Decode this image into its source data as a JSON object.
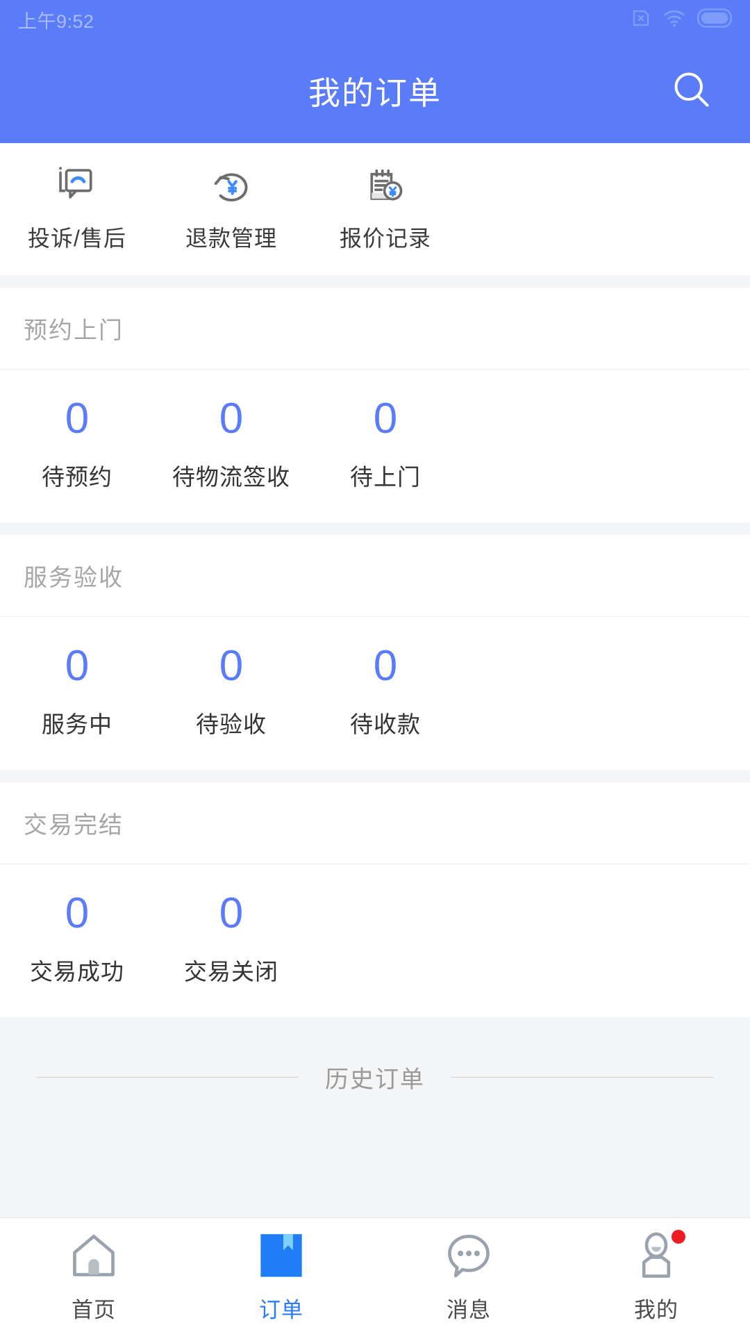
{
  "status_bar": {
    "time": "上午9:52",
    "icons": [
      "sim-no-card-icon",
      "wifi-icon",
      "battery-icon"
    ]
  },
  "app_bar": {
    "title": "我的订单",
    "search_icon": "search-icon"
  },
  "quick_actions": [
    {
      "label": "投诉/售后",
      "icon": "complaint-chat-icon"
    },
    {
      "label": "退款管理",
      "icon": "refund-yen-icon"
    },
    {
      "label": "报价记录",
      "icon": "quote-record-icon"
    }
  ],
  "sections": [
    {
      "title": "预约上门",
      "stats": [
        {
          "count": "0",
          "label": "待预约"
        },
        {
          "count": "0",
          "label": "待物流签收"
        },
        {
          "count": "0",
          "label": "待上门"
        }
      ]
    },
    {
      "title": "服务验收",
      "stats": [
        {
          "count": "0",
          "label": "服务中"
        },
        {
          "count": "0",
          "label": "待验收"
        },
        {
          "count": "0",
          "label": "待收款"
        }
      ]
    },
    {
      "title": "交易完结",
      "stats": [
        {
          "count": "0",
          "label": "交易成功"
        },
        {
          "count": "0",
          "label": "交易关闭"
        }
      ]
    }
  ],
  "history_divider": {
    "text": "历史订单"
  },
  "tab_bar": [
    {
      "label": "首页",
      "icon": "home-icon",
      "active": false,
      "badge": false
    },
    {
      "label": "订单",
      "icon": "order-bookmark-icon",
      "active": true,
      "badge": false
    },
    {
      "label": "消息",
      "icon": "message-bubble-icon",
      "active": false,
      "badge": false
    },
    {
      "label": "我的",
      "icon": "profile-person-icon",
      "active": false,
      "badge": true
    }
  ],
  "colors": {
    "brand_blue": "#5a7cf8",
    "accent_blue": "#2b7bf5",
    "page_bg": "#f4f5f6",
    "badge_red": "#ee1c25",
    "muted_gray": "#a6a6a6"
  }
}
